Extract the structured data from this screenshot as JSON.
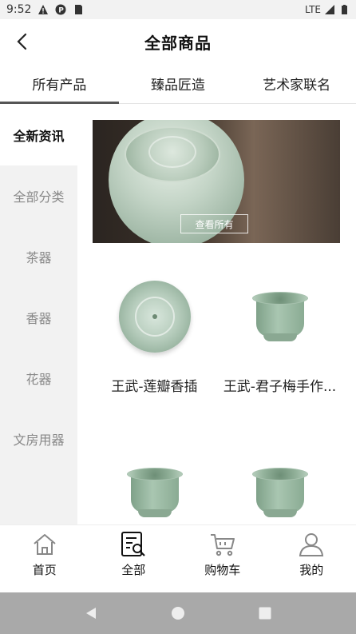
{
  "status_bar": {
    "time": "9:52",
    "network": "LTE",
    "icons": [
      "warning-icon",
      "p-icon",
      "sd-card-icon",
      "signal-icon",
      "battery-icon"
    ]
  },
  "header": {
    "title": "全部商品",
    "back_icon": "back-arrow-icon"
  },
  "tabs": [
    {
      "label": "所有产品",
      "active": true
    },
    {
      "label": "臻品匠造",
      "active": false
    },
    {
      "label": "艺术家联名",
      "active": false
    }
  ],
  "sidenav": {
    "items": [
      {
        "label": "全新资讯",
        "active": true
      },
      {
        "label": "全部分类",
        "active": false
      },
      {
        "label": "茶器",
        "active": false
      },
      {
        "label": "香器",
        "active": false
      },
      {
        "label": "花器",
        "active": false
      },
      {
        "label": "文房用器",
        "active": false
      }
    ]
  },
  "banner": {
    "button_label": "查看所有"
  },
  "products": [
    {
      "name": "王武-莲瓣香插"
    },
    {
      "name": "王武-君子梅手作..."
    },
    {
      "name": ""
    },
    {
      "name": ""
    }
  ],
  "tabbar": {
    "items": [
      {
        "label": "首页",
        "icon": "home-icon"
      },
      {
        "label": "全部",
        "icon": "catalog-search-icon",
        "active": true
      },
      {
        "label": "购物车",
        "icon": "cart-icon"
      },
      {
        "label": "我的",
        "icon": "user-icon"
      }
    ]
  },
  "colors": {
    "sidenav_bg": "#f2f2f2",
    "tab_indicator": "#555555",
    "sysnav_bg": "#a9a9a9"
  }
}
